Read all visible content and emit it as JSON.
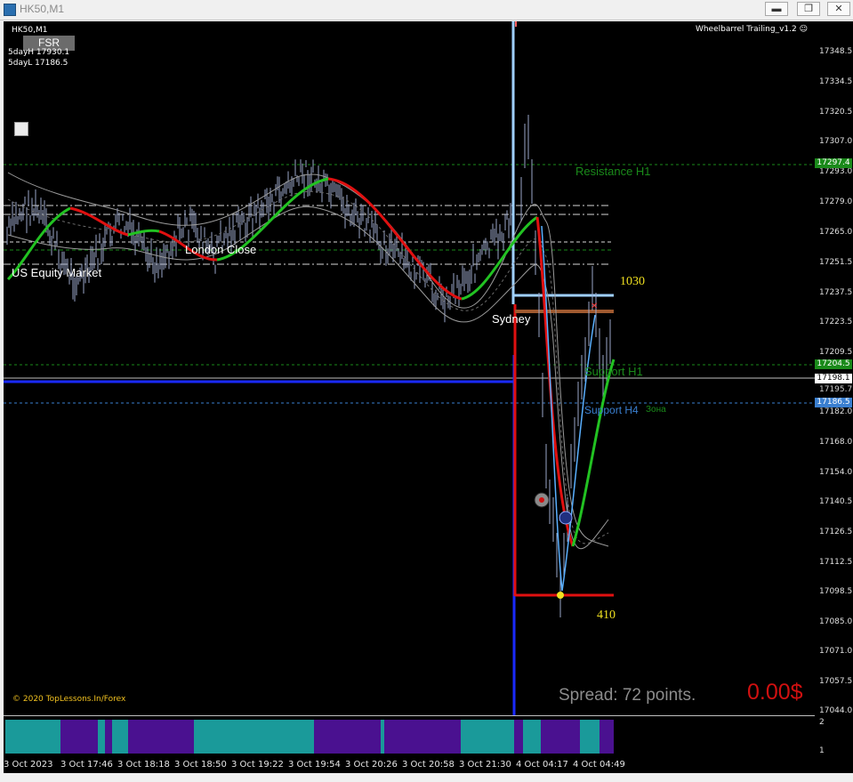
{
  "window": {
    "title": "HK50,M1",
    "minimize_glyph": "▬",
    "restore_glyph": "❐",
    "close_glyph": "✕"
  },
  "chart": {
    "symbol_label": "HK50,M1",
    "fsr_button": "FSR",
    "day_high": "5dayH 17930.1",
    "day_low": "5dayL 17186.5",
    "expert_name": "Wheelbarrel Trailing_v1.2",
    "expert_icon": "smiley-icon",
    "copyright": "© 2020 TopLessons.In/Forex",
    "spread_text": "Spread: 72 points.",
    "profit_text": "0.00$",
    "labels": {
      "us_equity": "US Equity Market",
      "london_close": "London Close",
      "sydney": "Sydney",
      "resistance_h1": "Resistance H1",
      "support_h1": "Support H1",
      "support_h4": "Support H4",
      "zone": "Зона",
      "range_top": "1030",
      "range_bottom": "410"
    },
    "colors": {
      "background": "#000000",
      "up_trend": "#22c222",
      "down_trend": "#e01010",
      "resistance": "#1a8a1a",
      "support_h4": "#3a7fd0",
      "bars": "#9aa6c8"
    }
  },
  "price_axis": {
    "ticks": [
      "17348.5",
      "17334.5",
      "17320.5",
      "17307.0",
      "17293.0",
      "17279.0",
      "17265.0",
      "17251.5",
      "17237.5",
      "17223.5",
      "17209.5",
      "17182.0",
      "17168.0",
      "17154.0",
      "17140.5",
      "17126.5",
      "17112.5",
      "17098.5",
      "17085.0",
      "17071.0",
      "17057.5",
      "17044.0"
    ],
    "markers": {
      "resistance": "17297.4",
      "support": "17204.5",
      "current": "17198.1",
      "current_under": "17195.7",
      "support_h4": "17186.5"
    }
  },
  "sub_indicator": {
    "scale_top": "2",
    "scale_bottom": "1",
    "colors": {
      "a": "#1a9a9a",
      "b": "#4a1190"
    }
  },
  "time_axis": {
    "ticks": [
      "3 Oct 2023",
      "3 Oct 17:46",
      "3 Oct 18:18",
      "3 Oct 18:50",
      "3 Oct 19:22",
      "3 Oct 19:54",
      "3 Oct 20:26",
      "3 Oct 20:58",
      "3 Oct 21:30",
      "4 Oct 04:17",
      "4 Oct 04:49"
    ]
  }
}
